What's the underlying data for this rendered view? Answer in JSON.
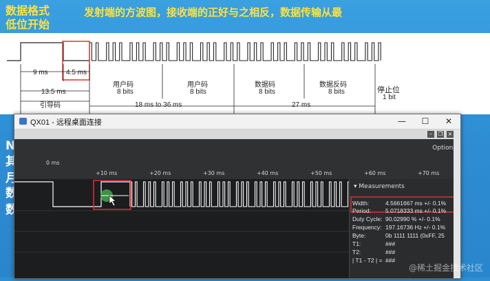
{
  "slide": {
    "title": "数据格式\n低位开始",
    "subtitle": "发射端的方波图，接收端的正好与之相反，数据传输从最",
    "side_chars": [
      "N",
      "其",
      "月",
      "数",
      "数"
    ]
  },
  "diagram": {
    "labels": {
      "t9": "9 ms",
      "t45": "4.5 ms",
      "t135": "13.5 ms",
      "lead": "引导码",
      "user1": "用户码",
      "user1b": "8 bits",
      "user2": "用户码",
      "user2b": "8 bits",
      "data": "数据码",
      "datab": "8 bits",
      "inv": "数据反码",
      "invb": "8 bits",
      "stop": "停止位",
      "stopb": "1 bit",
      "span1": "18 ms to 36 ms",
      "span2": "27 ms"
    }
  },
  "window": {
    "title": "QX01 - 远程桌面连接",
    "min": "—",
    "max": "☐",
    "close": "✕",
    "options": "Options"
  },
  "timeline": {
    "ticks": [
      "0 ms",
      "+10 ms",
      "+20 ms",
      "+30 ms",
      "+40 ms",
      "+50 ms",
      "+60 ms",
      "+70 ms"
    ]
  },
  "measurements": {
    "header": "Measurements",
    "rows": [
      {
        "k": "Width:",
        "v": "4.5661667 ms +/- 0.1%"
      },
      {
        "k": "Period:",
        "v": "5.0718333 ms +/- 0.1%"
      },
      {
        "k": "Duty Cycle:",
        "v": "90.02990 % +/- 0.1%"
      },
      {
        "k": "Frequency:",
        "v": "197.16736 Hz +/- 0.1%"
      },
      {
        "k": "Byte:",
        "v": "0b  1111  1111 (0xFF, 25"
      },
      {
        "k": "T1:",
        "v": "###"
      },
      {
        "k": "T2:",
        "v": "###"
      },
      {
        "k": "| T1 - T2 | =",
        "v": "###"
      }
    ]
  },
  "watermark": "@稀土掘金技术社区",
  "colors": {
    "highlight": "#e03030",
    "accent": "#ffe23a",
    "signal": "#ffffff"
  }
}
